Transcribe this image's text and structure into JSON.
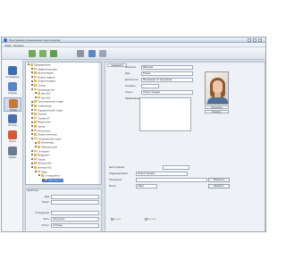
{
  "window": {
    "title": "Программа управления персоналом"
  },
  "menu": [
    "Файл",
    "Правка"
  ],
  "colors": {
    "accent": "#3b6fc1",
    "panel": "#eef1f5"
  },
  "toolbar": {
    "buttons": [
      "new-icon",
      "open-icon",
      "save-icon",
      "print-icon",
      "export-icon",
      "settings-icon"
    ]
  },
  "sidebar": {
    "items": [
      {
        "label": "Сотрудники",
        "icon": "person-icon"
      },
      {
        "label": "Отделы",
        "icon": "group-icon"
      },
      {
        "label": "Кадры",
        "icon": "card-icon"
      },
      {
        "label": "Отчеты",
        "icon": "report-icon"
      },
      {
        "label": "Поиск",
        "icon": "search-icon"
      },
      {
        "label": "Сервис",
        "icon": "tools-icon"
      }
    ]
  },
  "tree": {
    "nodes": [
      "Предприятие",
      "Администрация",
      "Бухгалтерия",
      "Отдел кадров",
      "Отдел продаж",
      "Склад",
      "Производство",
      "Цех №1",
      "Цех №2",
      "Транспортный отдел",
      "Снабжение",
      "Юридический отдел",
      "Охрана",
      "Служба IT",
      "Маркетинг",
      "Архив",
      "Логистика",
      "Отдел качества",
      "Технический отдел",
      "Инженеры",
      "Лаборатория",
      "Столовая",
      "Медпункт",
      "Гараж",
      "Филиал №1",
      "Филиал №2",
      "Офис",
      "Сотрудники",
      "Иванова Е.А."
    ]
  },
  "props": {
    "header": "Свойства",
    "rows": [
      {
        "label": "Имя",
        "value": ""
      },
      {
        "label": "Отдел",
        "value": ""
      },
      {
        "label": "Сотрудники",
        "value": ""
      },
      {
        "label": "Фото",
        "value": "Загрузить"
      },
      {
        "label": "Статус",
        "value": "Активен"
      }
    ]
  },
  "detail": {
    "tab": "Сведения",
    "fields": [
      {
        "label": "Фамилия",
        "value": "Иванова"
      },
      {
        "label": "Имя",
        "value": "Елена"
      },
      {
        "label": "Должность",
        "value": "Менеджер по продажам"
      },
      {
        "label": "Телефон",
        "value": ""
      },
      {
        "label": "Отдел",
        "value": "Отдел продаж"
      },
      {
        "label": "Примечание",
        "value": ""
      }
    ],
    "photo_buttons": [
      "Загрузить",
      "Удалить"
    ],
    "lower_fields": [
      {
        "label": "Дата приема",
        "value": ""
      },
      {
        "label": "Подразделение",
        "value": "Отдел продаж"
      },
      {
        "label": "Начальник",
        "value": ""
      },
      {
        "label": "Место",
        "value": "Офис"
      }
    ],
    "side_buttons": [
      "Изменить",
      "Выбрать"
    ],
    "checks": [
      "Архив",
      "Уволен"
    ]
  }
}
